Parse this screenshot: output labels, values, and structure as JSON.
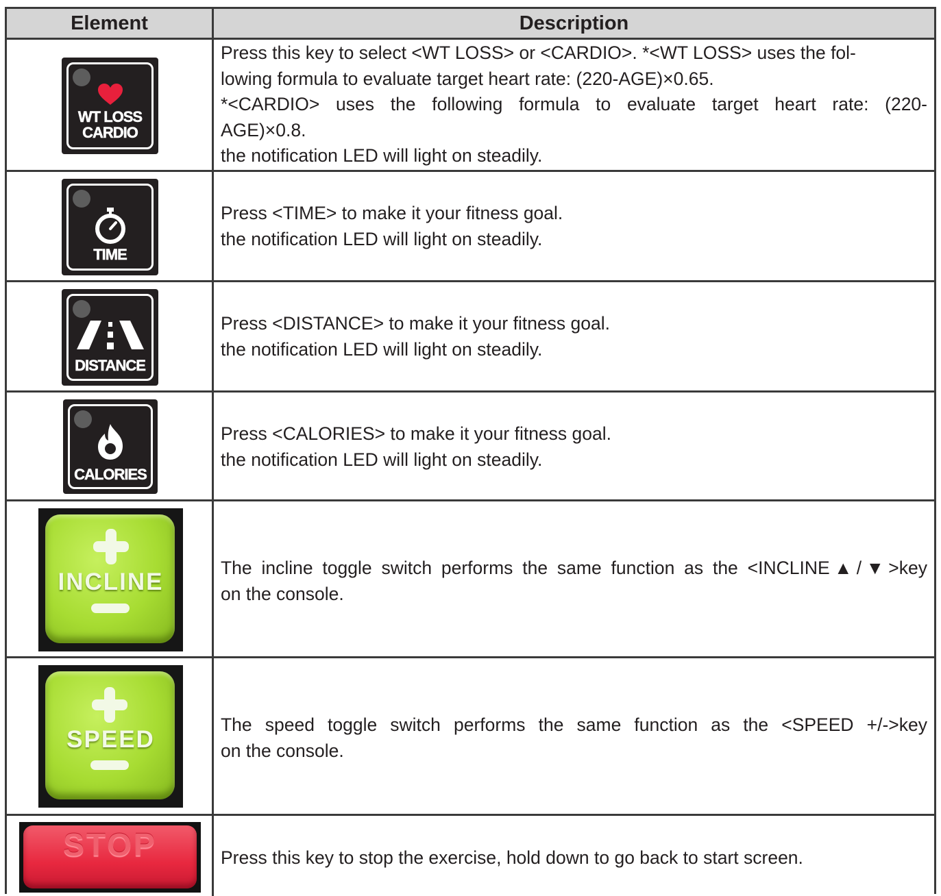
{
  "table": {
    "header": {
      "element": "Element",
      "description": "Description"
    },
    "rows": [
      {
        "key_label_line1": "WT LOSS",
        "key_label_line2": "CARDIO",
        "key_icon": "heart-icon",
        "description_lines": [
          "Press this key to select <WT LOSS> or <CARDIO>. *<WT LOSS> uses the fol-",
          "lowing formula to evaluate target heart rate: (220-AGE)×0.65.",
          "*<CARDIO> uses the following formula to evaluate target heart rate: (220-",
          "AGE)×0.8.",
          "the notification LED will light on steadily."
        ]
      },
      {
        "key_label_line1": "TIME",
        "key_icon": "stopwatch-icon",
        "description_lines": [
          "Press <TIME> to make it your fitness goal.",
          "the notification LED will light on steadily."
        ]
      },
      {
        "key_label_line1": "DISTANCE",
        "key_icon": "road-icon",
        "description_lines": [
          "Press <DISTANCE> to make it your fitness goal.",
          "the notification LED will light on steadily."
        ]
      },
      {
        "key_label_line1": "CALORIES",
        "key_icon": "flame-icon",
        "description_lines": [
          "Press <CALORIES> to make it your fitness goal.",
          "the notification LED will light on steadily."
        ]
      },
      {
        "key_label_line1": "INCLINE",
        "key_icon": "plus-minus-icon",
        "description_lines": [
          "The incline toggle switch performs the same function as the  <INCLINE▲/▼>key",
          "on the console."
        ]
      },
      {
        "key_label_line1": "SPEED",
        "key_icon": "plus-minus-icon",
        "description_lines": [
          "The speed toggle switch performs the same function as the  <SPEED +/->key",
          "on the console."
        ]
      },
      {
        "key_label_line1": "STOP",
        "description_lines": [
          "Press this key to stop the exercise, hold down to go back to start screen."
        ]
      }
    ]
  },
  "colors": {
    "header_bg": "#d5d5d5",
    "border": "#3a3a3a",
    "key_black": "#231f20",
    "heart_red": "#e8203c",
    "key_green": "#a7dc32",
    "key_red": "#e8283f"
  }
}
